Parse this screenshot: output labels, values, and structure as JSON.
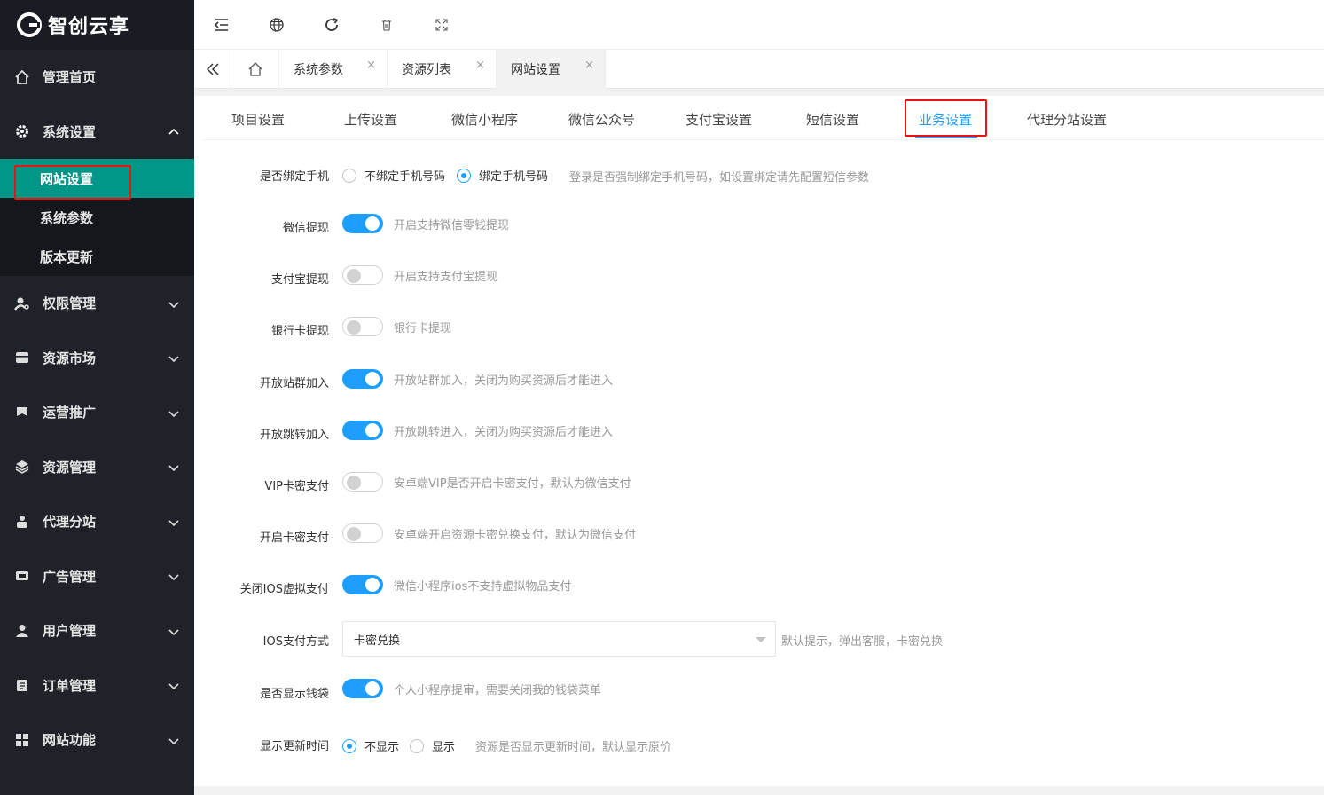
{
  "brand": {
    "name": "智创云享"
  },
  "sidebar": {
    "items": [
      {
        "label": "管理首页",
        "icon": "home-icon"
      },
      {
        "label": "系统设置",
        "icon": "gear-icon",
        "expanded": true,
        "children": [
          {
            "label": "网站设置",
            "active": true
          },
          {
            "label": "系统参数"
          },
          {
            "label": "版本更新"
          }
        ]
      },
      {
        "label": "权限管理",
        "icon": "key-user-icon"
      },
      {
        "label": "资源市场",
        "icon": "store-icon"
      },
      {
        "label": "运营推广",
        "icon": "flag-icon"
      },
      {
        "label": "资源管理",
        "icon": "layers-icon"
      },
      {
        "label": "代理分站",
        "icon": "users-group-icon"
      },
      {
        "label": "广告管理",
        "icon": "ad-icon"
      },
      {
        "label": "用户管理",
        "icon": "user-icon"
      },
      {
        "label": "订单管理",
        "icon": "clipboard-icon"
      },
      {
        "label": "网站功能",
        "icon": "grid-icon"
      }
    ]
  },
  "header": {
    "icons": [
      "menu-fold-icon",
      "globe-icon",
      "refresh-icon",
      "trash-icon",
      "fullscreen-icon"
    ]
  },
  "tabs": [
    {
      "label": "系统参数",
      "closable": true
    },
    {
      "label": "资源列表",
      "closable": true
    },
    {
      "label": "网站设置",
      "closable": true,
      "active": true
    }
  ],
  "close_glyph": "×",
  "sub_tabs": [
    "项目设置",
    "上传设置",
    "微信小程序",
    "微信公众号",
    "支付宝设置",
    "短信设置",
    "业务设置",
    "代理分站设置"
  ],
  "sub_tabs_active": "业务设置",
  "form": {
    "bind_phone": {
      "label": "是否绑定手机",
      "options": [
        "不绑定手机号码",
        "绑定手机号码"
      ],
      "selected": "绑定手机号码",
      "help": "登录是否强制绑定手机号码，如设置绑定请先配置短信参数"
    },
    "wechat_withdraw": {
      "label": "微信提现",
      "on": true,
      "help": "开启支持微信零钱提现"
    },
    "alipay_withdraw": {
      "label": "支付宝提现",
      "on": false,
      "help": "开启支持支付宝提现"
    },
    "bank_withdraw": {
      "label": "银行卡提现",
      "on": false,
      "help": "银行卡提现"
    },
    "open_site_join": {
      "label": "开放站群加入",
      "on": true,
      "help": "开放站群加入，关闭为购买资源后才能进入"
    },
    "open_jump_join": {
      "label": "开放跳转加入",
      "on": true,
      "help": "开放跳转进入，关闭为购买资源后才能进入"
    },
    "vip_card_pay": {
      "label": "VIP卡密支付",
      "on": false,
      "help": "安卓端VIP是否开启卡密支付，默认为微信支付"
    },
    "card_pay": {
      "label": "开启卡密支付",
      "on": false,
      "help": "安卓端开启资源卡密兑换支付，默认为微信支付"
    },
    "ios_virtual": {
      "label": "关闭IOS虚拟支付",
      "on": true,
      "help": "微信小程序ios不支持虚拟物品支付"
    },
    "ios_pay_mode": {
      "label": "IOS支付方式",
      "value": "卡密兑换",
      "help": "默认提示，弹出客服，卡密兑换"
    },
    "show_wallet": {
      "label": "是否显示钱袋",
      "on": true,
      "help": "个人小程序提审，需要关闭我的钱袋菜单"
    },
    "show_update_time": {
      "label": "显示更新时间",
      "options": [
        "不显示",
        "显示"
      ],
      "selected": "不显示",
      "help": "资源是否显示更新时间，默认显示原价"
    }
  },
  "colors": {
    "sidebar_bg": "#20222a",
    "active_green": "#009688",
    "accent_blue": "#1e9fff",
    "highlight_red": "#ee1111"
  }
}
